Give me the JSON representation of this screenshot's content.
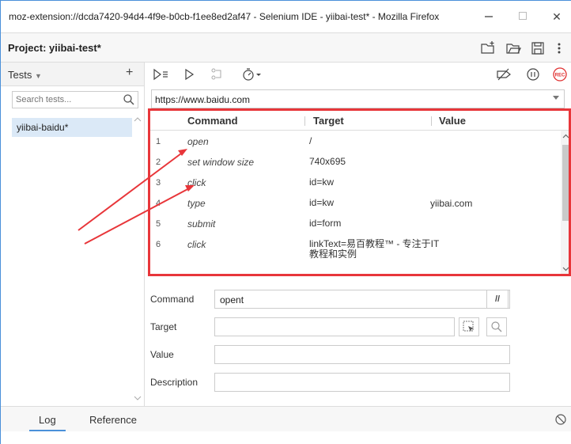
{
  "window": {
    "title": "moz-extension://dcda7420-94d4-4f9e-b0cb-f1ee8ed2af47 - Selenium IDE - yiibai-test* - Mozilla Firefox",
    "minimize_icon": "minimize-icon",
    "maximize_icon": "maximize-icon",
    "close_label": "✕"
  },
  "project": {
    "name": "Project: yiibai-test*",
    "icons": [
      "new-folder-icon",
      "open-folder-icon",
      "save-icon",
      "more-vertical-icon"
    ]
  },
  "sidebar": {
    "dropdown_label": "Tests",
    "add_label": "+",
    "search_placeholder": "Search tests...",
    "items": [
      {
        "label": "yiibai-baidu*"
      }
    ]
  },
  "toolbar": {
    "icons": [
      "run-all-tests-icon",
      "run-current-test-icon",
      "step-icon",
      "speed-timer-icon",
      "disable-breakpoints-icon",
      "pause-icon",
      "record-icon"
    ],
    "record_label": "REC"
  },
  "base_url": "https://www.baidu.com",
  "table": {
    "headers": {
      "command": "Command",
      "target": "Target",
      "value": "Value"
    },
    "rows": [
      {
        "num": "1",
        "command": "open",
        "target": "/",
        "value": ""
      },
      {
        "num": "2",
        "command": "set window size",
        "target": "740x695",
        "value": ""
      },
      {
        "num": "3",
        "command": "click",
        "target": "id=kw",
        "value": ""
      },
      {
        "num": "4",
        "command": "type",
        "target": "id=kw",
        "value": "yiibai.com"
      },
      {
        "num": "5",
        "command": "submit",
        "target": "id=form",
        "value": ""
      },
      {
        "num": "6",
        "command": "click",
        "target": "linkText=易百教程™ - 专注于IT教程和实例",
        "value": ""
      }
    ]
  },
  "editor": {
    "command_label": "Command",
    "command_value": "opent",
    "comment_button": "//",
    "target_label": "Target",
    "target_value": "",
    "value_label": "Value",
    "value_value": "",
    "description_label": "Description",
    "description_value": ""
  },
  "bottom": {
    "tabs": [
      "Log",
      "Reference"
    ],
    "active_tab": "Log"
  },
  "colors": {
    "accent": "#4a90d9",
    "highlight": "#e8363a",
    "selected_row": "#dbe9f7",
    "record": "#e03030"
  }
}
